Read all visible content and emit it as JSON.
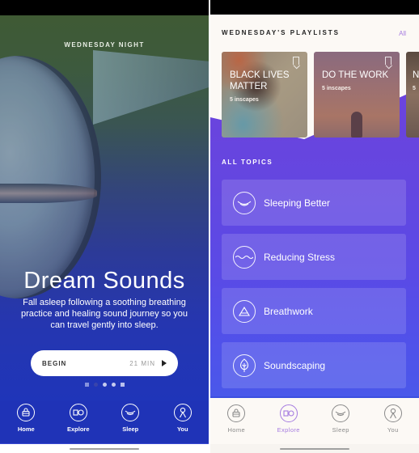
{
  "left_screen": {
    "hero": {
      "label": "WEDNESDAY NIGHT",
      "title": "Dream Sounds",
      "description": "Fall asleep following a soothing breathing practice and healing sound journey so you can travel gently into sleep.",
      "begin_label": "BEGIN",
      "duration": "21 MIN",
      "play_icon": "play-icon",
      "pagination": {
        "total": 5,
        "active_index": 3
      }
    },
    "nav": {
      "items": [
        {
          "label": "Home",
          "icon": "home-icon"
        },
        {
          "label": "Explore",
          "icon": "explore-icon"
        },
        {
          "label": "Sleep",
          "icon": "sleep-icon"
        },
        {
          "label": "You",
          "icon": "profile-icon"
        }
      ],
      "active": "Sleep"
    }
  },
  "right_screen": {
    "playlists": {
      "title": "WEDNESDAY'S PLAYLISTS",
      "all_link": "All",
      "items": [
        {
          "title": "BLACK LIVES MATTER",
          "count": "5 inscapes"
        },
        {
          "title": "DO THE WORK",
          "count": "5 inscapes"
        },
        {
          "title": "N",
          "count": "5"
        }
      ]
    },
    "topics": {
      "title": "ALL TOPICS",
      "items": [
        {
          "label": "Sleeping Better",
          "icon": "sleep-wave-icon"
        },
        {
          "label": "Reducing Stress",
          "icon": "water-wave-icon"
        },
        {
          "label": "Breathwork",
          "icon": "triangle-icon"
        },
        {
          "label": "Soundscaping",
          "icon": "leaf-icon"
        }
      ]
    },
    "nav": {
      "items": [
        {
          "label": "Home",
          "icon": "home-icon"
        },
        {
          "label": "Explore",
          "icon": "explore-icon"
        },
        {
          "label": "Sleep",
          "icon": "sleep-icon"
        },
        {
          "label": "You",
          "icon": "profile-icon"
        }
      ],
      "active": "Explore"
    }
  },
  "colors": {
    "accent": "#a57be0",
    "left_nav_bg": "#1f33b7",
    "topics_bg": "#6446e0"
  }
}
